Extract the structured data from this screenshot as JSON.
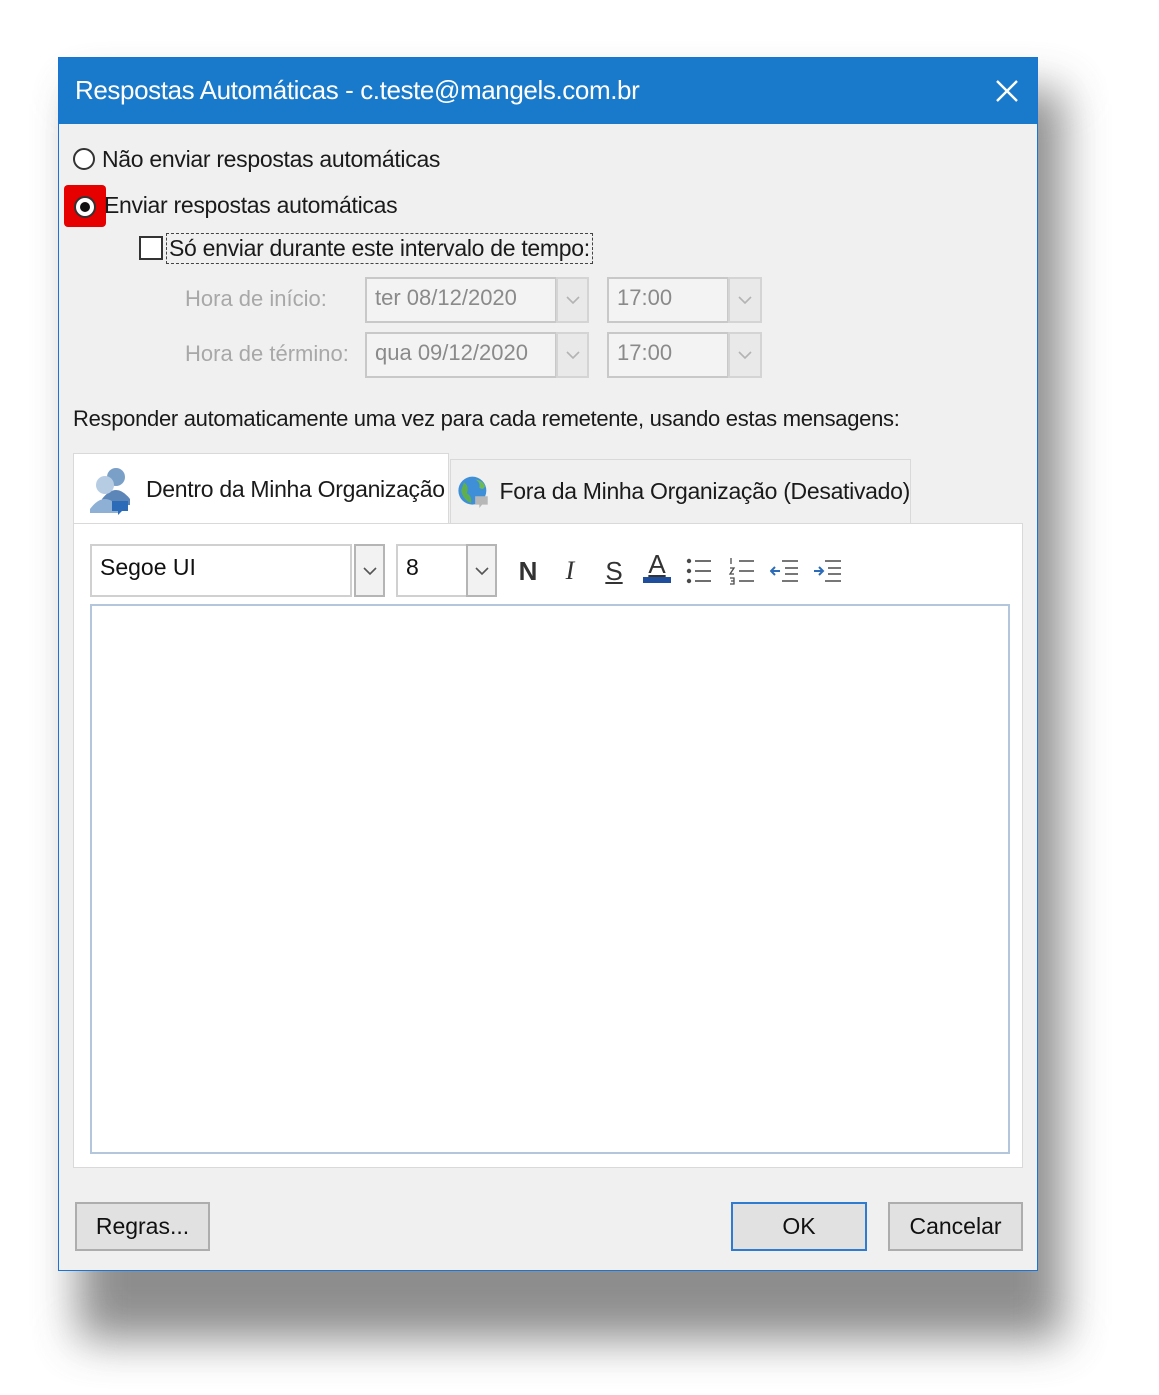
{
  "window": {
    "title": "Respostas Automáticas - c.teste@mangels.com.br",
    "close_icon": "close-icon"
  },
  "options": {
    "no_reply_label": "Não enviar respostas automáticas",
    "send_reply_label": "Enviar respostas automáticas",
    "send_reply_selected": true,
    "time_range_label": "Só enviar durante este intervalo de tempo:",
    "time_range_checked": false
  },
  "schedule": {
    "start_label": "Hora de início:",
    "start_date": "ter 08/12/2020",
    "start_time": "17:00",
    "end_label": "Hora de término:",
    "end_date": "qua 09/12/2020",
    "end_time": "17:00"
  },
  "reply_instructions": "Responder automaticamente uma vez para cada remetente, usando estas mensagens:",
  "tabs": [
    {
      "label": "Dentro da Minha Organização",
      "icon": "people-icon",
      "active": true
    },
    {
      "label": "Fora da Minha Organização (Desativado)",
      "icon": "globe-icon",
      "active": false
    }
  ],
  "formatting": {
    "font_name": "Segoe UI",
    "font_size": "8",
    "bold_label": "N",
    "italic_label": "I",
    "underline_label": "S",
    "font_color_label": "A",
    "font_color": "#1f4e9c"
  },
  "editor": {
    "content": ""
  },
  "buttons": {
    "rules_label": "Regras...",
    "ok_label": "OK",
    "cancel_label": "Cancelar"
  },
  "colors": {
    "titlebar": "#1979ca",
    "highlight": "#e60000",
    "default_button_border": "#2f7bd1"
  }
}
